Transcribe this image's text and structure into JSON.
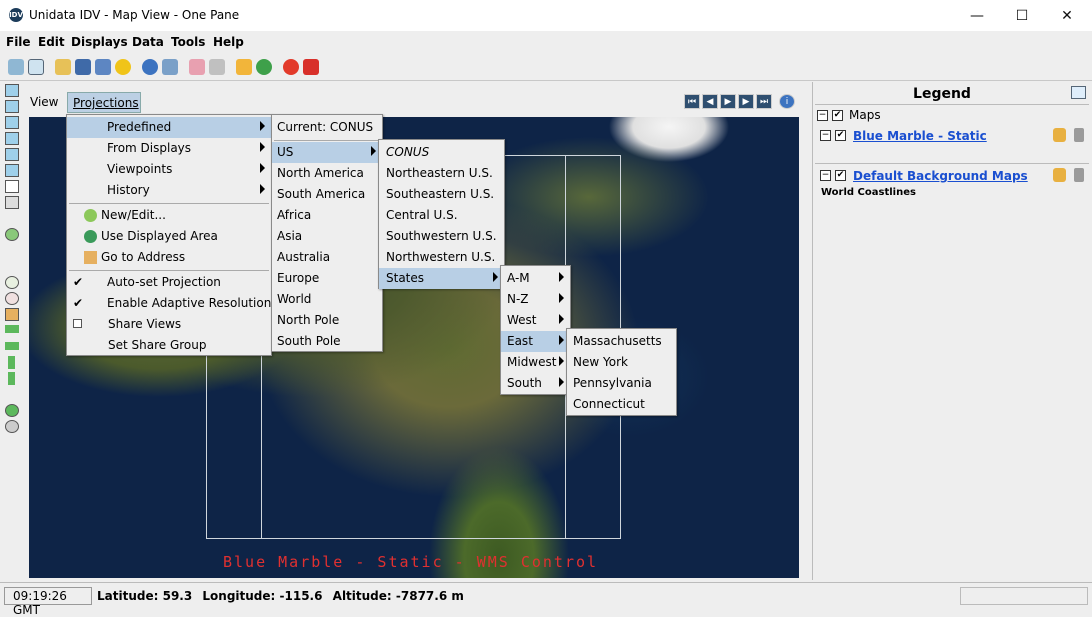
{
  "window": {
    "title": "Unidata IDV - Map View - One Pane",
    "app_icon": "idv-logo-icon",
    "minimize": "—",
    "maximize": "☐",
    "close": "✕"
  },
  "menubar": [
    "File",
    "Edit",
    "Displays",
    "Data",
    "Tools",
    "Help"
  ],
  "view_tabs": {
    "view": "View",
    "projections": "Projections"
  },
  "animation_controls": [
    "⏮",
    "◀",
    "▶",
    "▶",
    "⏭",
    "i"
  ],
  "projections_menu": {
    "predefined": "Predefined",
    "from_displays": "From Displays",
    "viewpoints": "Viewpoints",
    "history": "History",
    "new_edit": "New/Edit...",
    "use_displayed_area": "Use Displayed Area",
    "go_to_address": "Go to Address",
    "auto_set_projection": "Auto-set Projection",
    "enable_adaptive_resolution": "Enable Adaptive Resolution",
    "share_views": "Share Views",
    "set_share_group": "Set Share Group"
  },
  "predefined_menu": {
    "current": "Current: CONUS",
    "items": [
      "US",
      "North America",
      "South America",
      "Africa",
      "Asia",
      "Australia",
      "Europe",
      "World",
      "North Pole",
      "South Pole"
    ]
  },
  "us_menu": {
    "items": [
      "CONUS",
      "Northeastern U.S.",
      "Southeastern U.S.",
      "Central U.S.",
      "Southwestern U.S.",
      "Northwestern U.S.",
      "States"
    ]
  },
  "states_menu": {
    "items": [
      "A-M",
      "N-Z",
      "West",
      "East",
      "Midwest",
      "South"
    ]
  },
  "east_menu": {
    "items": [
      "Massachusetts",
      "New York",
      "Pennsylvania",
      "Connecticut"
    ]
  },
  "map": {
    "overlay_label": "Blue Marble - Static - WMS Control"
  },
  "legend": {
    "title": "Legend",
    "group": "Maps",
    "layers": [
      {
        "name": "Blue Marble - Static",
        "sub": ""
      },
      {
        "name": "Default Background Maps",
        "sub": "World Coastlines"
      }
    ]
  },
  "status": {
    "time": "09:19:26 GMT",
    "latitude_label": "Latitude:",
    "latitude": "59.3",
    "longitude_label": "Longitude:",
    "longitude": "-115.6",
    "altitude_label": "Altitude:",
    "altitude": "-7877.6 m"
  },
  "colors": {
    "menu_selected": "#b8cfe5",
    "link": "#1a4fd0",
    "overlay_label": "#e03030"
  }
}
